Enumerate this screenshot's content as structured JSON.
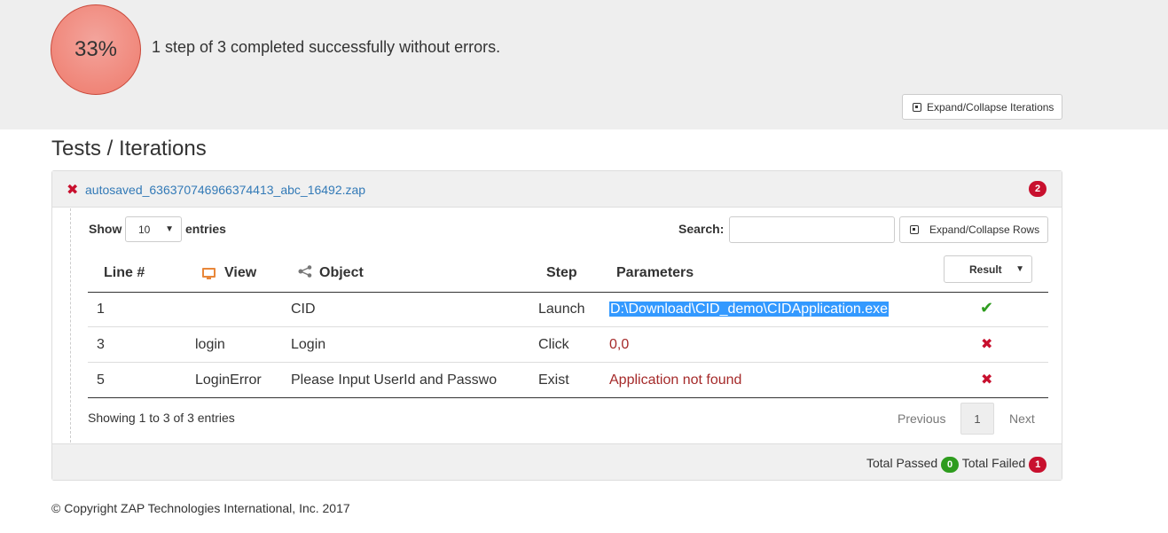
{
  "summary": {
    "percent": "33%",
    "text": "1 step of 3 completed successfully without errors.",
    "expand_iterations_label": "Expand/Collapse Iterations"
  },
  "section_title": "Tests / Iterations",
  "iteration": {
    "filename": "autosaved_636370746966374413_abc_16492.zap",
    "badge": "2",
    "status_icon": "x-icon"
  },
  "controls": {
    "show_label": "Show",
    "entries_value": "10",
    "entries_label": "entries",
    "search_label": "Search:",
    "search_value": "",
    "expand_rows_label": "Expand/Collapse Rows"
  },
  "table": {
    "headers": {
      "line": "Line #",
      "view": "View",
      "object": "Object",
      "step": "Step",
      "parameters": "Parameters",
      "result": "Result"
    },
    "rows": [
      {
        "line": "1",
        "view": "",
        "object": "CID",
        "step": "Launch",
        "parameters": "D:\\Download\\CID_demo\\CIDApplication.exe",
        "result": "pass"
      },
      {
        "line": "3",
        "view": "login",
        "object": "Login",
        "step": "Click",
        "parameters": "0,0",
        "result": "fail"
      },
      {
        "line": "5",
        "view": "LoginError",
        "object": "Please Input UserId and Passwo",
        "step": "Exist",
        "parameters": "Application not found",
        "result": "fail"
      }
    ]
  },
  "pagination": {
    "info": "Showing 1 to 3 of 3 entries",
    "previous": "Previous",
    "current": "1",
    "next": "Next"
  },
  "totals": {
    "passed_label": "Total Passed",
    "passed": "0",
    "failed_label": "Total Failed",
    "failed": "1"
  },
  "footer": {
    "copyright": "© Copyright ZAP Technologies International, Inc. 2017"
  },
  "colors": {
    "progress": "#ef7a6b",
    "pass": "#2e9c1e",
    "fail": "#c8102e",
    "link": "#337ab7",
    "selection": "#3399ff"
  }
}
